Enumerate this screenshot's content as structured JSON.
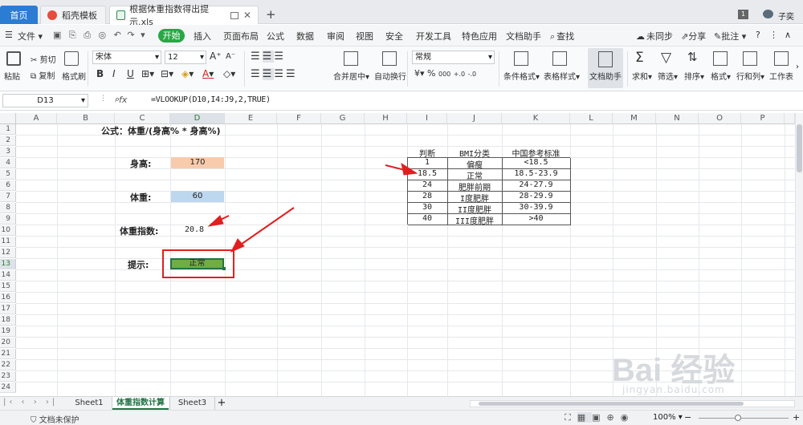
{
  "tabs": {
    "home": "首页",
    "template": "稻壳模板",
    "document": "根据体重指数得出提示.xls",
    "add": "+"
  },
  "account": {
    "badge": "1",
    "user": "子奕"
  },
  "menu": {
    "file": "文件",
    "start": "开始",
    "items": [
      "插入",
      "页面布局",
      "公式",
      "数据",
      "审阅",
      "视图",
      "安全",
      "开发工具",
      "特色应用",
      "文档助手"
    ],
    "search": "查找",
    "sync": "未同步",
    "share": "分享",
    "comment": "批注",
    "help": "?"
  },
  "ribbon": {
    "paste": "粘贴",
    "cut": "剪切",
    "copy": "复制",
    "format_painter": "格式刷",
    "font_name": "宋体",
    "font_size": "12",
    "bold": "B",
    "italic": "I",
    "underline": "U",
    "merge": "合并居中",
    "wrap": "自动换行",
    "number_format": "常规",
    "cond_format": "条件格式",
    "table_style": "表格样式",
    "doc_helper": "文档助手",
    "sum": "求和",
    "filter": "筛选",
    "sort": "排序",
    "format": "格式",
    "rows_cols": "行和列",
    "worksheet": "工作表"
  },
  "formula_bar": {
    "name_box": "D13",
    "fx": "fx",
    "formula": "=VLOOKUP(D10,I4:J9,2,TRUE)"
  },
  "columns": [
    "A",
    "B",
    "C",
    "D",
    "E",
    "F",
    "G",
    "H",
    "I",
    "J",
    "K",
    "L",
    "M",
    "N",
    "O",
    "P"
  ],
  "rows": [
    "1",
    "2",
    "3",
    "4",
    "5",
    "6",
    "7",
    "8",
    "9",
    "10",
    "11",
    "12",
    "13",
    "14",
    "15",
    "16",
    "17",
    "18",
    "19",
    "20",
    "21",
    "22",
    "23",
    "24"
  ],
  "sheet": {
    "formula_title": "公式：体重/(身高% * 身高%)",
    "height_label": "身高:",
    "height_value": "170",
    "weight_label": "体重:",
    "weight_value": "60",
    "bmi_label": "体重指数:",
    "bmi_value": "20.8",
    "hint_label": "提示:",
    "hint_value": "正常",
    "table_header": [
      "判断",
      "BMI分类",
      "中国参考标准"
    ],
    "table_rows": [
      [
        "1",
        "偏瘦",
        "<18.5"
      ],
      [
        "18.5",
        "正常",
        "18.5-23.9"
      ],
      [
        "24",
        "肥胖前期",
        "24-27.9"
      ],
      [
        "28",
        "I度肥胖",
        "28-29.9"
      ],
      [
        "30",
        "II度肥胖",
        "30-39.9"
      ],
      [
        "40",
        "III度肥胖",
        ">40"
      ]
    ]
  },
  "colors": {
    "height_fill": "#f8cbad",
    "weight_fill": "#bdd7ee",
    "hint_fill": "#70ad47",
    "annotation": "#e02020",
    "accent": "#2b7cd3"
  },
  "sheet_tabs": [
    "Sheet1",
    "体重指数计算",
    "Sheet3"
  ],
  "status": {
    "protect": "文档未保护",
    "zoom": "100%"
  },
  "watermark": {
    "text": "Bai 经验",
    "url": "jingyan.baidu.com"
  }
}
